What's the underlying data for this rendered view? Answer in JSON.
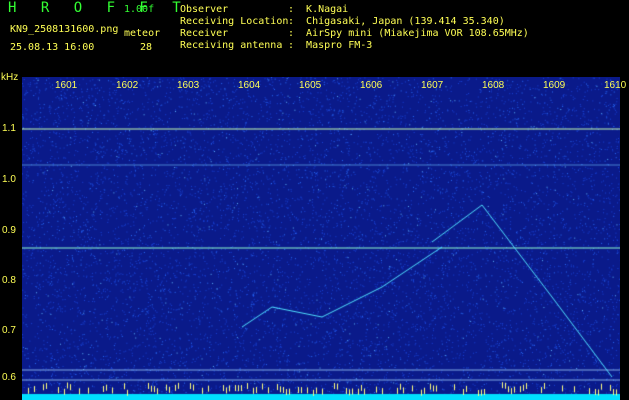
{
  "header": {
    "logo": "H R O F F T",
    "version": "1.00f",
    "filename": "KN9_2508131600.png",
    "timestamp": "25.08.13 16:00",
    "meteor_label": "meteor",
    "meteor_count": "28",
    "fields": [
      {
        "label": "Observer",
        "value": ":  K.Nagai"
      },
      {
        "label": "Receiving Location",
        "value": ":  Chigasaki, Japan (139.414 35.340)"
      },
      {
        "label": "Receiver",
        "value": ":  AirSpy mini (Miakejima VOR 108.65MHz)"
      },
      {
        "label": "Receiving antenna",
        "value": ":  Maspro FM-3"
      }
    ]
  },
  "axes": {
    "y_unit": "kHz",
    "x_ticks": [
      "1601",
      "1602",
      "1603",
      "1604",
      "1605",
      "1606",
      "1607",
      "1608",
      "1609",
      "1610"
    ],
    "y_ticks": [
      "1.1",
      "1.0",
      "0.9",
      "0.8",
      "0.7",
      "0.6"
    ]
  },
  "colors": {
    "background": "#000000",
    "spectrogram_bg": "#0a1a8a",
    "noise": "#1e5cff",
    "signal": "#7fffd4",
    "label_yellow": "#ffff55",
    "label_green": "#33ff33"
  }
}
